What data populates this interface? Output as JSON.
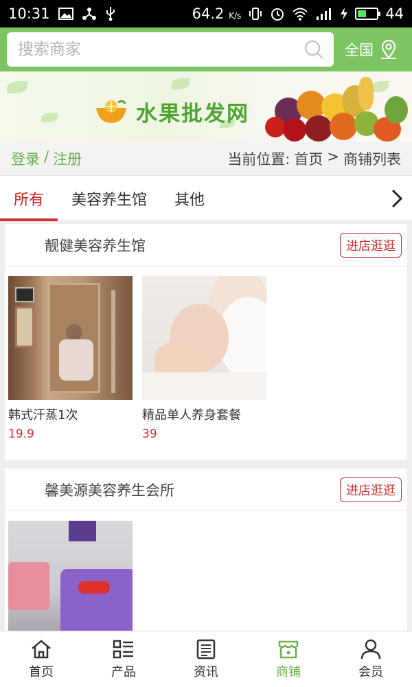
{
  "status_bar": {
    "time": "10:31",
    "net_speed": "64.2",
    "net_unit": "K/s",
    "battery": "44",
    "battery_level": 0.44
  },
  "header": {
    "search_placeholder": "搜索商家",
    "region_label": "全国"
  },
  "banner": {
    "site_name": "水果批发网"
  },
  "breadcrumb": {
    "login": "登录",
    "sep": "/",
    "register": "注册",
    "prefix": "当前位置:",
    "home": "首页",
    "arrow": ">",
    "current": "商铺列表"
  },
  "tabs": [
    {
      "label": "所有",
      "active": true
    },
    {
      "label": "美容养生馆",
      "active": false
    },
    {
      "label": "其他",
      "active": false
    }
  ],
  "shops": [
    {
      "name": "靓健美容养生馆",
      "visit_label": "进店逛逛",
      "products": [
        {
          "name": "韩式汗蒸1次",
          "price": "19.9"
        },
        {
          "name": "精品单人养身套餐",
          "price": "39"
        }
      ]
    },
    {
      "name": "馨美源美容养生会所",
      "visit_label": "进店逛逛",
      "products": [
        {
          "name": "",
          "price": ""
        }
      ]
    }
  ],
  "bottom_nav": [
    {
      "label": "首页",
      "icon": "home-icon",
      "active": false
    },
    {
      "label": "产品",
      "icon": "list-icon",
      "active": false
    },
    {
      "label": "资讯",
      "icon": "news-icon",
      "active": false
    },
    {
      "label": "商铺",
      "icon": "store-icon",
      "active": true
    },
    {
      "label": "会员",
      "icon": "user-icon",
      "active": false
    }
  ],
  "colors": {
    "brand_green": "#7dc462",
    "accent_red": "#d32f2f",
    "active_green": "#6ab14f"
  }
}
